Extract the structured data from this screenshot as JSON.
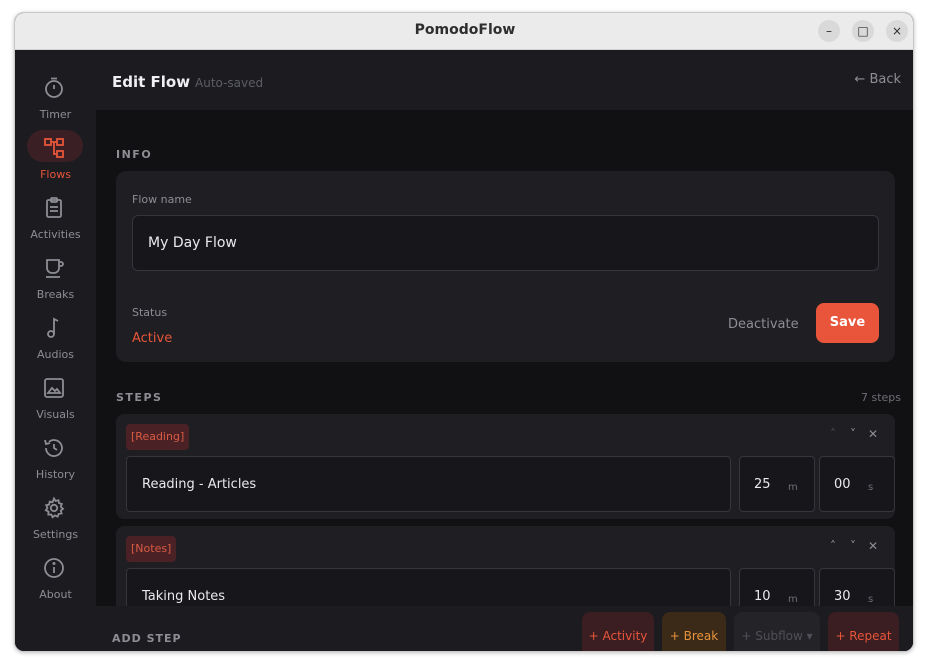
{
  "window": {
    "title": "PomodoFlow",
    "controls": [
      "–",
      "□",
      "×"
    ]
  },
  "sidebar": {
    "items": [
      {
        "label": "Timer",
        "icon": "timer-icon"
      },
      {
        "label": "Flows",
        "icon": "flows-icon",
        "active": true
      },
      {
        "label": "Activities",
        "icon": "clipboard-icon"
      },
      {
        "label": "Breaks",
        "icon": "cup-icon"
      },
      {
        "label": "Audios",
        "icon": "music-note-icon"
      },
      {
        "label": "Visuals",
        "icon": "image-icon"
      },
      {
        "label": "History",
        "icon": "history-icon"
      },
      {
        "label": "Settings",
        "icon": "gear-icon"
      },
      {
        "label": "About",
        "icon": "info-icon"
      }
    ]
  },
  "header": {
    "title": "Edit Flow",
    "subtitle": "Auto-saved",
    "back_arrow": "←",
    "back_label": "Back"
  },
  "info": {
    "section_label": "INFO",
    "flow_name_label": "Flow name",
    "flow_name_value": "My Day Flow",
    "status_label": "Status",
    "status_value": "Active",
    "deactivate_label": "Deactivate",
    "save_label": "Save"
  },
  "steps": {
    "section_label": "STEPS",
    "count_label": "7 steps",
    "items": [
      {
        "tag": "[Reading]",
        "name": "Reading - Articles",
        "minutes": "25",
        "minutes_unit": "m",
        "seconds": "00",
        "seconds_unit": "s"
      },
      {
        "tag": "[Notes]",
        "name": "Taking Notes",
        "minutes": "10",
        "minutes_unit": "m",
        "seconds": "30",
        "seconds_unit": "s"
      }
    ],
    "control_glyphs": {
      "up": "˄",
      "down": "˅",
      "remove": "✕"
    }
  },
  "footer": {
    "add_step_label": "ADD STEP",
    "buttons": {
      "activity": "+ Activity",
      "break": "+ Break",
      "subflow": "+ Subflow ▾",
      "repeat": "+ Repeat"
    }
  },
  "colors": {
    "accent": "#e8553a",
    "break_accent": "#e8923a",
    "background": "#111114",
    "card": "#1e1e23"
  }
}
